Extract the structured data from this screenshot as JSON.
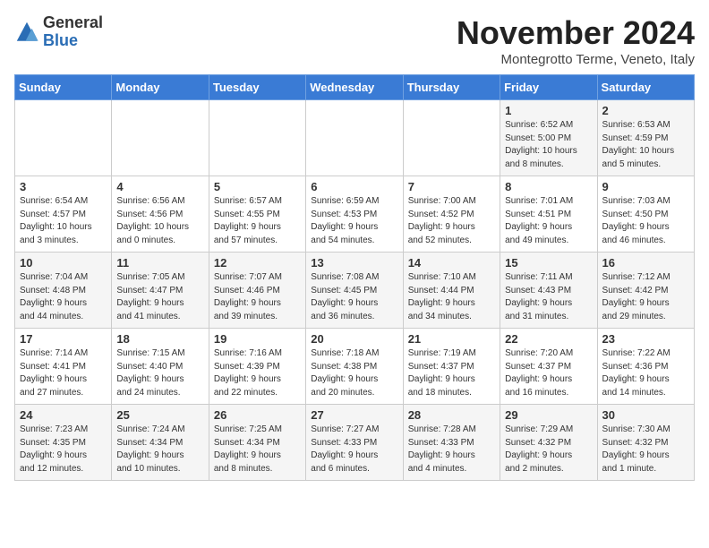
{
  "header": {
    "logo": {
      "line1": "General",
      "line2": "Blue"
    },
    "title": "November 2024",
    "subtitle": "Montegrotto Terme, Veneto, Italy"
  },
  "days_of_week": [
    "Sunday",
    "Monday",
    "Tuesday",
    "Wednesday",
    "Thursday",
    "Friday",
    "Saturday"
  ],
  "weeks": [
    [
      {
        "day": "",
        "info": ""
      },
      {
        "day": "",
        "info": ""
      },
      {
        "day": "",
        "info": ""
      },
      {
        "day": "",
        "info": ""
      },
      {
        "day": "",
        "info": ""
      },
      {
        "day": "1",
        "info": "Sunrise: 6:52 AM\nSunset: 5:00 PM\nDaylight: 10 hours\nand 8 minutes."
      },
      {
        "day": "2",
        "info": "Sunrise: 6:53 AM\nSunset: 4:59 PM\nDaylight: 10 hours\nand 5 minutes."
      }
    ],
    [
      {
        "day": "3",
        "info": "Sunrise: 6:54 AM\nSunset: 4:57 PM\nDaylight: 10 hours\nand 3 minutes."
      },
      {
        "day": "4",
        "info": "Sunrise: 6:56 AM\nSunset: 4:56 PM\nDaylight: 10 hours\nand 0 minutes."
      },
      {
        "day": "5",
        "info": "Sunrise: 6:57 AM\nSunset: 4:55 PM\nDaylight: 9 hours\nand 57 minutes."
      },
      {
        "day": "6",
        "info": "Sunrise: 6:59 AM\nSunset: 4:53 PM\nDaylight: 9 hours\nand 54 minutes."
      },
      {
        "day": "7",
        "info": "Sunrise: 7:00 AM\nSunset: 4:52 PM\nDaylight: 9 hours\nand 52 minutes."
      },
      {
        "day": "8",
        "info": "Sunrise: 7:01 AM\nSunset: 4:51 PM\nDaylight: 9 hours\nand 49 minutes."
      },
      {
        "day": "9",
        "info": "Sunrise: 7:03 AM\nSunset: 4:50 PM\nDaylight: 9 hours\nand 46 minutes."
      }
    ],
    [
      {
        "day": "10",
        "info": "Sunrise: 7:04 AM\nSunset: 4:48 PM\nDaylight: 9 hours\nand 44 minutes."
      },
      {
        "day": "11",
        "info": "Sunrise: 7:05 AM\nSunset: 4:47 PM\nDaylight: 9 hours\nand 41 minutes."
      },
      {
        "day": "12",
        "info": "Sunrise: 7:07 AM\nSunset: 4:46 PM\nDaylight: 9 hours\nand 39 minutes."
      },
      {
        "day": "13",
        "info": "Sunrise: 7:08 AM\nSunset: 4:45 PM\nDaylight: 9 hours\nand 36 minutes."
      },
      {
        "day": "14",
        "info": "Sunrise: 7:10 AM\nSunset: 4:44 PM\nDaylight: 9 hours\nand 34 minutes."
      },
      {
        "day": "15",
        "info": "Sunrise: 7:11 AM\nSunset: 4:43 PM\nDaylight: 9 hours\nand 31 minutes."
      },
      {
        "day": "16",
        "info": "Sunrise: 7:12 AM\nSunset: 4:42 PM\nDaylight: 9 hours\nand 29 minutes."
      }
    ],
    [
      {
        "day": "17",
        "info": "Sunrise: 7:14 AM\nSunset: 4:41 PM\nDaylight: 9 hours\nand 27 minutes."
      },
      {
        "day": "18",
        "info": "Sunrise: 7:15 AM\nSunset: 4:40 PM\nDaylight: 9 hours\nand 24 minutes."
      },
      {
        "day": "19",
        "info": "Sunrise: 7:16 AM\nSunset: 4:39 PM\nDaylight: 9 hours\nand 22 minutes."
      },
      {
        "day": "20",
        "info": "Sunrise: 7:18 AM\nSunset: 4:38 PM\nDaylight: 9 hours\nand 20 minutes."
      },
      {
        "day": "21",
        "info": "Sunrise: 7:19 AM\nSunset: 4:37 PM\nDaylight: 9 hours\nand 18 minutes."
      },
      {
        "day": "22",
        "info": "Sunrise: 7:20 AM\nSunset: 4:37 PM\nDaylight: 9 hours\nand 16 minutes."
      },
      {
        "day": "23",
        "info": "Sunrise: 7:22 AM\nSunset: 4:36 PM\nDaylight: 9 hours\nand 14 minutes."
      }
    ],
    [
      {
        "day": "24",
        "info": "Sunrise: 7:23 AM\nSunset: 4:35 PM\nDaylight: 9 hours\nand 12 minutes."
      },
      {
        "day": "25",
        "info": "Sunrise: 7:24 AM\nSunset: 4:34 PM\nDaylight: 9 hours\nand 10 minutes."
      },
      {
        "day": "26",
        "info": "Sunrise: 7:25 AM\nSunset: 4:34 PM\nDaylight: 9 hours\nand 8 minutes."
      },
      {
        "day": "27",
        "info": "Sunrise: 7:27 AM\nSunset: 4:33 PM\nDaylight: 9 hours\nand 6 minutes."
      },
      {
        "day": "28",
        "info": "Sunrise: 7:28 AM\nSunset: 4:33 PM\nDaylight: 9 hours\nand 4 minutes."
      },
      {
        "day": "29",
        "info": "Sunrise: 7:29 AM\nSunset: 4:32 PM\nDaylight: 9 hours\nand 2 minutes."
      },
      {
        "day": "30",
        "info": "Sunrise: 7:30 AM\nSunset: 4:32 PM\nDaylight: 9 hours\nand 1 minute."
      }
    ]
  ]
}
